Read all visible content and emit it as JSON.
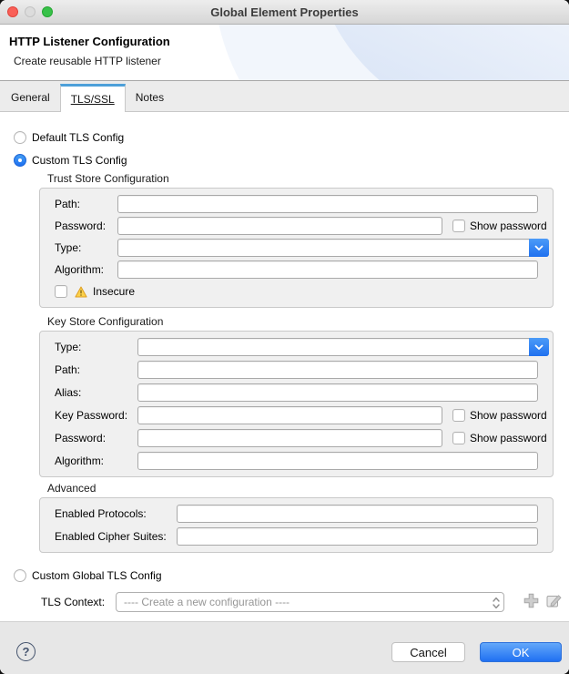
{
  "window": {
    "title": "Global Element Properties"
  },
  "header": {
    "title": "HTTP Listener Configuration",
    "subtitle": "Create reusable HTTP listener"
  },
  "tabs": [
    {
      "label": "General",
      "active": false
    },
    {
      "label": "TLS/SSL",
      "active": true
    },
    {
      "label": "Notes",
      "active": false
    }
  ],
  "main": {
    "default_tls": {
      "label": "Default TLS Config",
      "selected": false
    },
    "custom_tls": {
      "label": "Custom TLS Config",
      "selected": true
    },
    "trust_store": {
      "title": "Trust Store Configuration",
      "path_label": "Path:",
      "password_label": "Password:",
      "show_password_label": "Show password",
      "show_password_checked": false,
      "type_label": "Type:",
      "algorithm_label": "Algorithm:",
      "insecure_label": "Insecure",
      "insecure_checked": false
    },
    "key_store": {
      "title": "Key Store Configuration",
      "type_label": "Type:",
      "path_label": "Path:",
      "alias_label": "Alias:",
      "key_password_label": "Key Password:",
      "password_label": "Password:",
      "show_password_label": "Show password",
      "show_password_checked": false,
      "algorithm_label": "Algorithm:"
    },
    "advanced": {
      "title": "Advanced",
      "enabled_protocols_label": "Enabled Protocols:",
      "enabled_cipher_suites_label": "Enabled Cipher Suites:"
    },
    "custom_global_tls": {
      "label": "Custom Global TLS Config",
      "selected": false
    },
    "tls_context": {
      "label": "TLS Context:",
      "selected_option": "---- Create a new configuration ----"
    }
  },
  "footer": {
    "help_label": "?",
    "cancel_label": "Cancel",
    "ok_label": "OK"
  },
  "icons": {
    "combo_chevron": "chevron-down",
    "warning": "warning-triangle",
    "select_stepper": "up-down-stepper",
    "add": "plus",
    "edit": "edit-pencil"
  },
  "colors": {
    "tab_accent": "#4da0d9",
    "combo_button_blue": "#2e7ff4",
    "radio_selected_blue": "#1d6ff0",
    "ok_button_blue": "#2070f2",
    "warning_fill": "#fbd14b",
    "group_background": "#f0f0f0"
  }
}
